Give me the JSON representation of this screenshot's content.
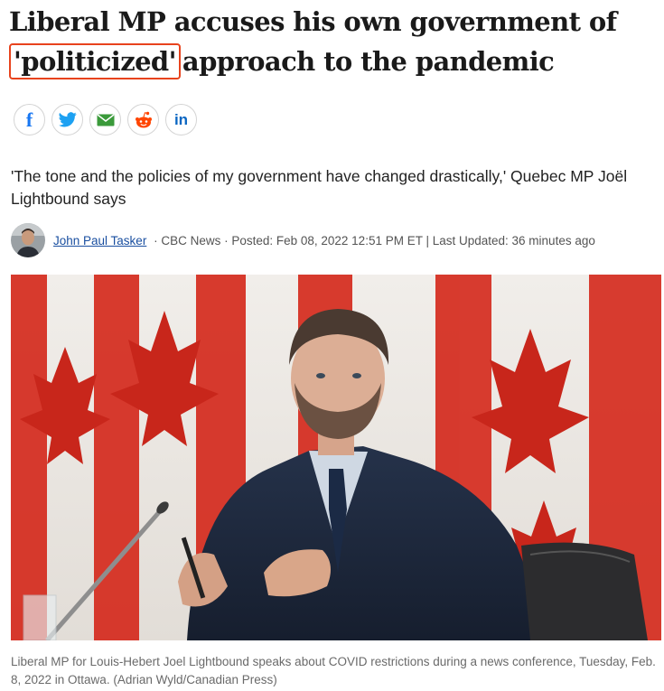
{
  "article": {
    "headline_highlight": "'politicized'",
    "headline_part1": "Liberal MP accuses his own government of",
    "headline_part2": "approach to the pandemic",
    "deck": "'The tone and the policies of my government have changed drastically,' Quebec MP Joël Lightbound says",
    "author": "John Paul Tasker",
    "meta": " · CBC News · Posted: Feb 08, 2022 12:51 PM ET | Last Updated: 36 minutes ago",
    "caption": "Liberal MP for Louis-Hebert Joel Lightbound speaks about COVID restrictions during a news conference, Tuesday, Feb. 8, 2022 in Ottawa. (Adrian Wyld/Canadian Press)"
  },
  "share": {
    "buttons": [
      {
        "icon": "facebook-icon",
        "text": "f",
        "color": "#1877f2"
      },
      {
        "icon": "twitter-icon",
        "color": "#1da1f2"
      },
      {
        "icon": "email-icon",
        "color": "#3a9a3a"
      },
      {
        "icon": "reddit-icon",
        "color": "#ff4500"
      },
      {
        "icon": "linkedin-icon",
        "text": "in",
        "color": "#0a66c2"
      }
    ]
  },
  "colors": {
    "highlight_border": "#e8431d",
    "author_link": "#1a4fa0",
    "flag_red": "#d52b1e"
  }
}
